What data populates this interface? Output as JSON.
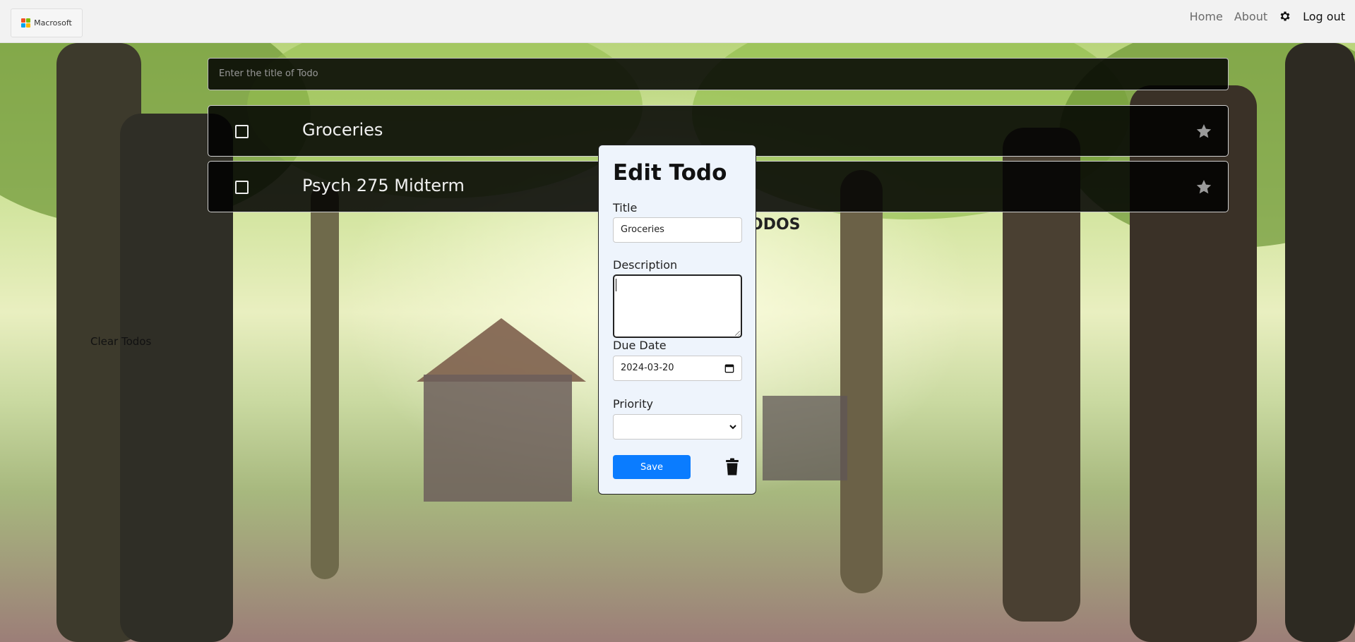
{
  "header": {
    "logo_text": "Macrosoft",
    "nav": {
      "home": "Home",
      "about": "About",
      "logout": "Log out"
    }
  },
  "main": {
    "input_placeholder": "Enter the title of Todo",
    "todos": [
      {
        "title": "Groceries"
      },
      {
        "title": "Psych 275 Midterm"
      }
    ],
    "section_heading": "ODOS",
    "clear_label": "Clear Todos"
  },
  "modal": {
    "title": "Edit Todo",
    "title_label": "Title",
    "title_value": "Groceries",
    "description_label": "Description",
    "description_value": "",
    "due_label": "Due Date",
    "due_value": "2024-03-20",
    "priority_label": "Priority",
    "priority_value": "",
    "save_label": "Save"
  },
  "colors": {
    "accent": "#0a7cff",
    "card": "#000000",
    "modal_bg": "#eef4fc"
  }
}
